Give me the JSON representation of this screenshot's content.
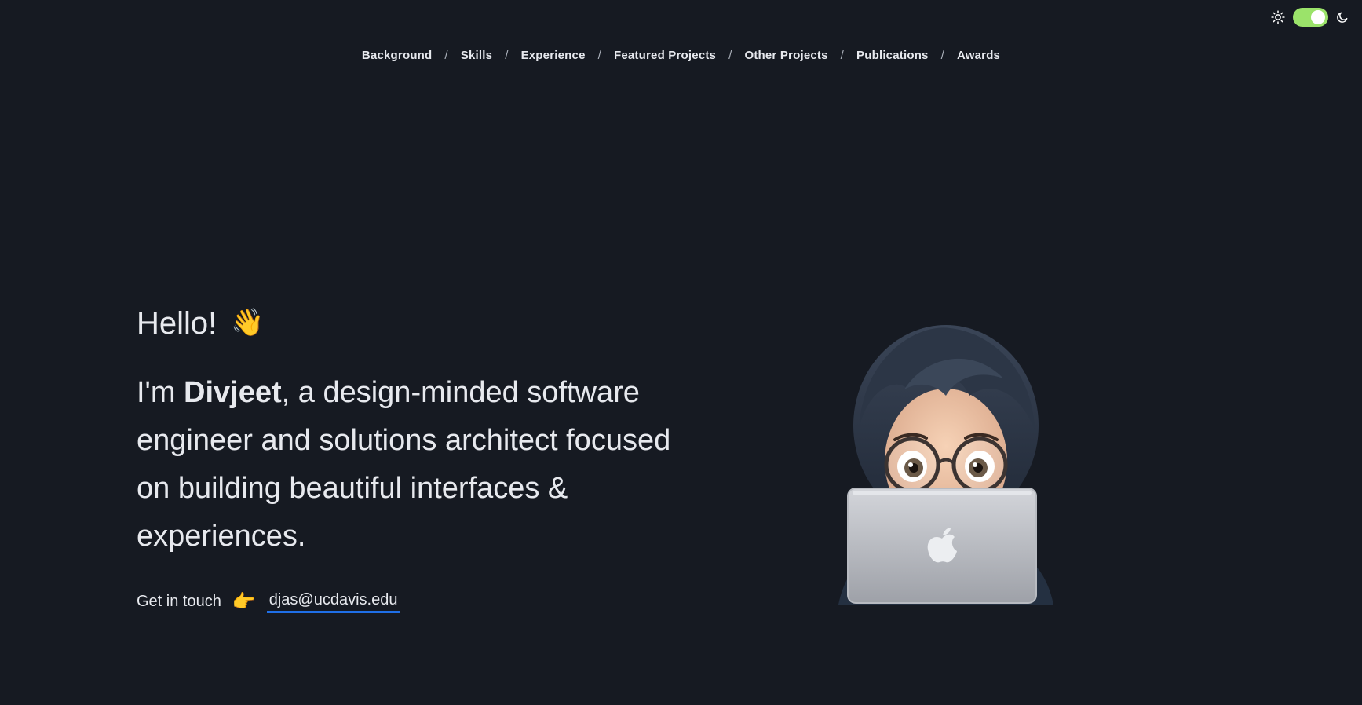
{
  "theme": {
    "toggle_state": "on",
    "accent_color": "#9be36a",
    "left_icon": "sun-icon",
    "right_icon": "moon-icon"
  },
  "nav": {
    "items": [
      {
        "label": "Background"
      },
      {
        "label": "Skills"
      },
      {
        "label": "Experience"
      },
      {
        "label": "Featured Projects"
      },
      {
        "label": "Other Projects"
      },
      {
        "label": "Publications"
      },
      {
        "label": "Awards"
      }
    ],
    "separator": "/"
  },
  "hero": {
    "greeting": "Hello!",
    "greeting_emoji": "👋",
    "intro_prefix": "I'm ",
    "name": "Divjeet",
    "intro_suffix": ", a design-minded software engineer and solutions architect focused on building beautiful interfaces & experiences.",
    "contact_label": "Get in touch",
    "contact_emoji": "👉",
    "email": "djas@ucdavis.edu",
    "email_underline_color": "#1f6fe8"
  },
  "illustration": {
    "icon": "memoji-with-laptop-icon"
  }
}
